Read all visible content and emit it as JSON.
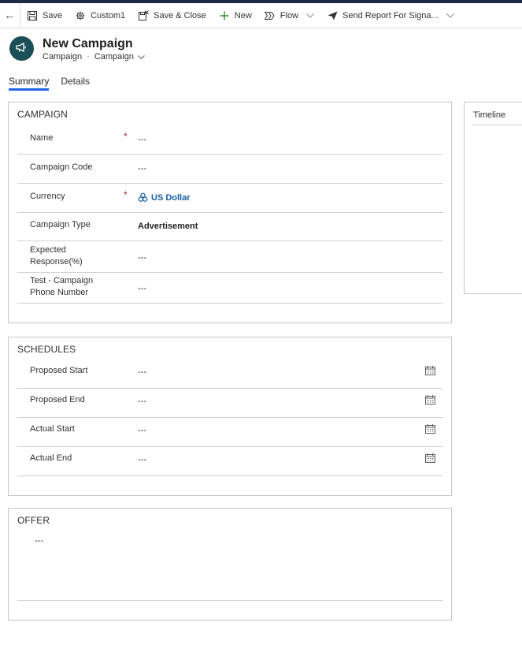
{
  "toolbar": {
    "items": [
      {
        "label": "Save",
        "icon": "save-icon"
      },
      {
        "label": "Custom1",
        "icon": "gear-icon"
      },
      {
        "label": "Save & Close",
        "icon": "save-close-icon"
      },
      {
        "label": "New",
        "icon": "plus-icon"
      },
      {
        "label": "Flow",
        "icon": "flow-icon"
      },
      {
        "label": "Send Report For Signa...",
        "icon": "send-icon"
      }
    ]
  },
  "header": {
    "title": "New Campaign",
    "entity": "Campaign",
    "form": "Campaign"
  },
  "tabs": [
    "Summary",
    "Details"
  ],
  "campaign": {
    "title": "CAMPAIGN",
    "fields": [
      {
        "label": "Name",
        "value": "---",
        "required": true
      },
      {
        "label": "Campaign Code",
        "value": "---"
      },
      {
        "label": "Currency",
        "value": "US Dollar",
        "required": true
      },
      {
        "label": "Campaign Type",
        "value": "Advertisement"
      },
      {
        "label_line1": "Expected",
        "label_line2": "Response(%)",
        "value": "---"
      },
      {
        "label_line1": "Test - Campaign",
        "label_line2": "Phone Number",
        "value": "---"
      }
    ]
  },
  "schedules": {
    "title": "SCHEDULES",
    "fields": [
      {
        "label": "Proposed Start",
        "value": "---"
      },
      {
        "label": "Proposed End",
        "value": "---"
      },
      {
        "label": "Actual Start",
        "value": "---"
      },
      {
        "label": "Actual End",
        "value": "---"
      }
    ]
  },
  "offer": {
    "title": "OFFER",
    "value": "---"
  },
  "timeline": {
    "title": "Timeline"
  },
  "colors": {
    "accent": "#2266e3",
    "avatar": "#1b4f58",
    "required": "#a4262c",
    "link": "#115ea3"
  }
}
